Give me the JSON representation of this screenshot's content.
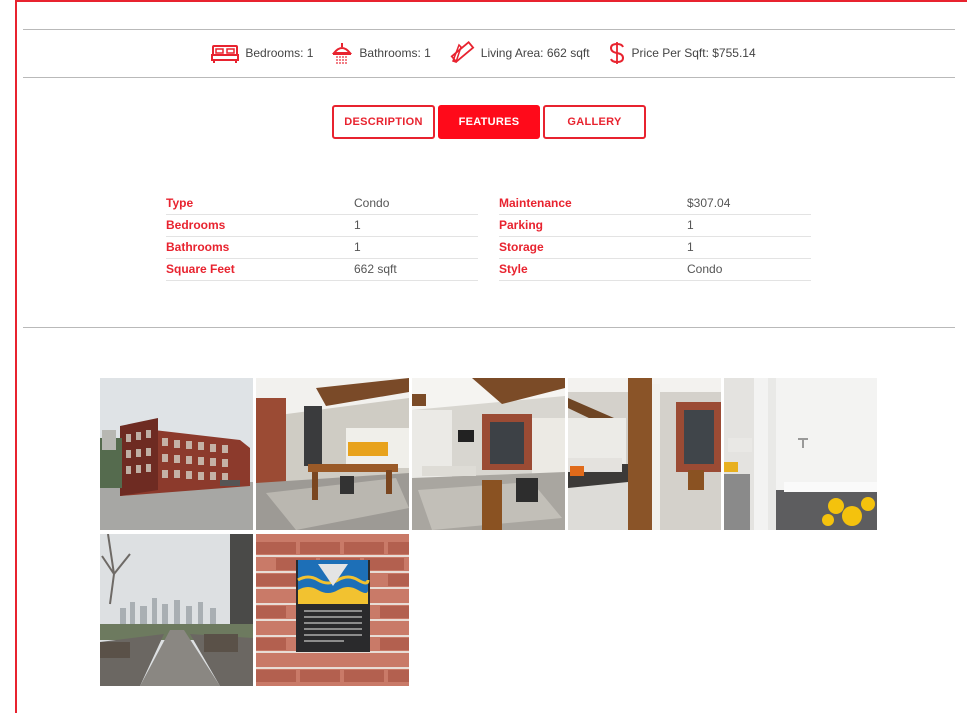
{
  "stats": [
    {
      "icon": "bed-icon",
      "label": "Bedrooms: 1"
    },
    {
      "icon": "shower-icon",
      "label": "Bathrooms: 1"
    },
    {
      "icon": "ruler-icon",
      "label": "Living Area: 662 sqft"
    },
    {
      "icon": "dollar-icon",
      "label": "Price Per Sqft: $755.14"
    }
  ],
  "tabs": [
    {
      "label": "DESCRIPTION",
      "active": false
    },
    {
      "label": "FEATURES",
      "active": true
    },
    {
      "label": "GALLERY",
      "active": false
    }
  ],
  "features_left": [
    {
      "label": "Type",
      "value": "Condo"
    },
    {
      "label": "Bedrooms",
      "value": "1"
    },
    {
      "label": "Bathrooms",
      "value": "1"
    },
    {
      "label": "Square Feet",
      "value": "662 sqft"
    }
  ],
  "features_right": [
    {
      "label": "Maintenance",
      "value": "$307.04"
    },
    {
      "label": "Parking",
      "value": "1"
    },
    {
      "label": "Storage",
      "value": "1"
    },
    {
      "label": "Style",
      "value": "Condo"
    }
  ],
  "colors": {
    "accent": "#e8232f",
    "accent_fill": "#ff0a1a"
  }
}
